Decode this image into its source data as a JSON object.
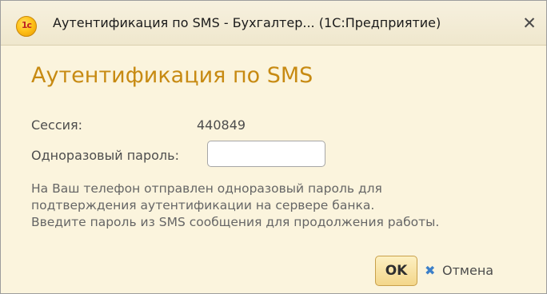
{
  "window": {
    "title": "Аутентификация по SMS - Бухгалтер... (1С:Предприятие)",
    "app_icon_glyph": "1c",
    "app_icon": "1c-logo-icon",
    "close_symbol": "✕"
  },
  "form": {
    "heading": "Аутентификация по SMS",
    "session_label": "Сессия:",
    "session_value": "440849",
    "password_label": "Одноразовый пароль:",
    "password_value": "",
    "info_lines": [
      "На Ваш телефон отправлен одноразовый пароль для",
      "подтверждения аутентификации на сервере банка.",
      "Введите пароль из SMS сообщения для продолжения работы."
    ]
  },
  "buttons": {
    "ok_label": "OK",
    "cancel_label": "Отмена",
    "cancel_icon": "cancel-x-icon"
  },
  "colors": {
    "background": "#fbf4dd",
    "heading": "#c78a12",
    "cancel_icon": "#3c7fc9"
  }
}
